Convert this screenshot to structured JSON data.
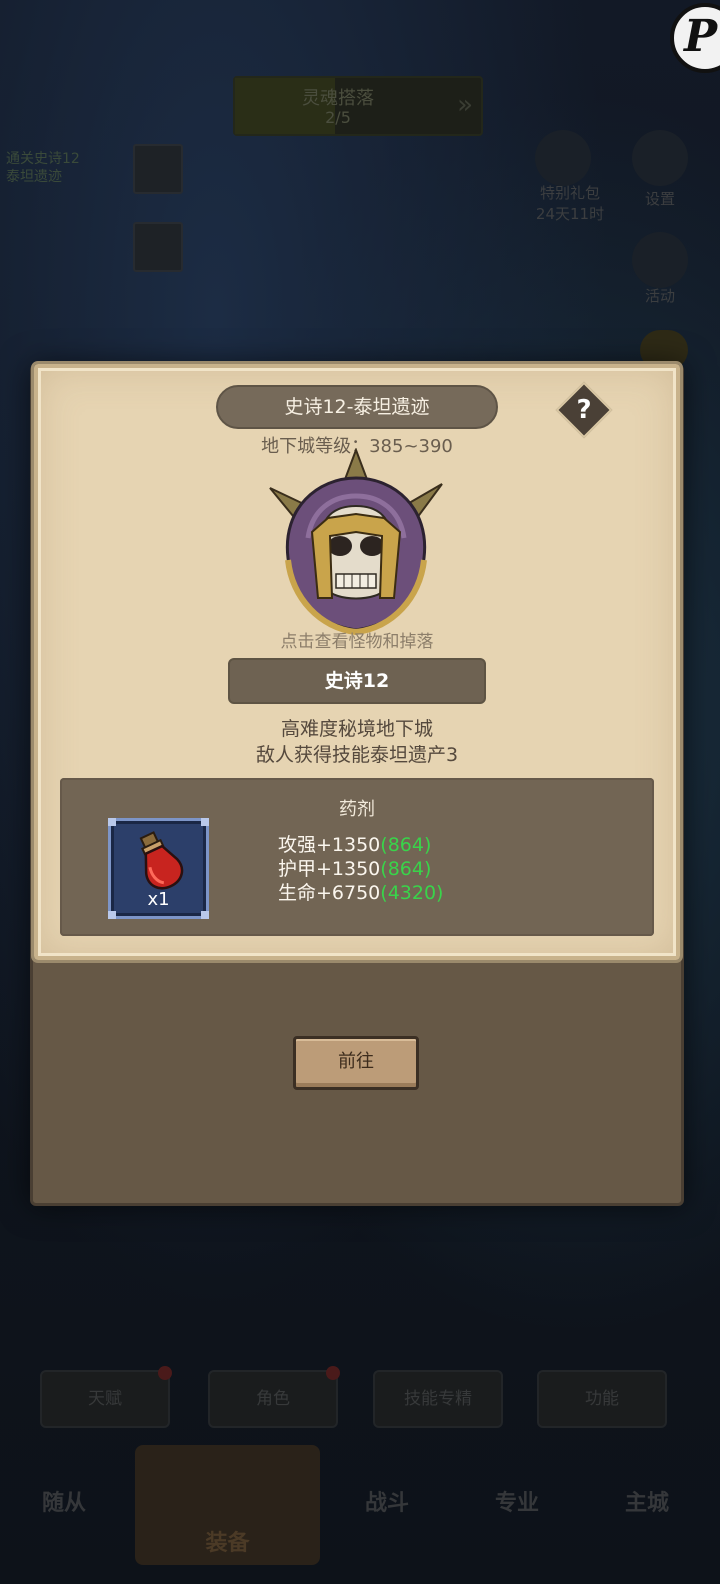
{
  "background": {
    "progress_title": "灵魂搭落",
    "progress_count": "2/5",
    "left_text_1": "通关史诗12",
    "left_text_2": "泰坦遗迹",
    "right_label_1": "特别礼包",
    "right_label_1_sub": "24天11时",
    "right_label_2": "设置",
    "right_label_3": "活动",
    "tabs": [
      "天赋",
      "角色",
      "技能专精",
      "功能"
    ],
    "nav": [
      "随从",
      "装备",
      "战斗",
      "专业",
      "主城"
    ]
  },
  "modal": {
    "title": "史诗12-泰坦遗迹",
    "help_label": "?",
    "dungeon_level": "地下城等级：385~390",
    "boss_hint": "点击查看怪物和掉落",
    "stage_label": "史诗12",
    "desc_line_1": "高难度秘境地下城",
    "desc_line_2": "敌人获得技能泰坦遗产3",
    "reward": {
      "title": "药剂",
      "item_icon": "red-potion-icon",
      "quantity": "x1",
      "stats": [
        {
          "label": "攻强+1350",
          "bonus": "(864)"
        },
        {
          "label": "护甲+1350",
          "bonus": "(864)"
        },
        {
          "label": "生命+6750",
          "bonus": "(4320)"
        }
      ]
    },
    "go_button": "前往"
  },
  "colors": {
    "paper": "#e6d4b2",
    "panel": "#665846",
    "bonus_green": "#39d44a",
    "item_border_blue": "#7d95c8"
  }
}
